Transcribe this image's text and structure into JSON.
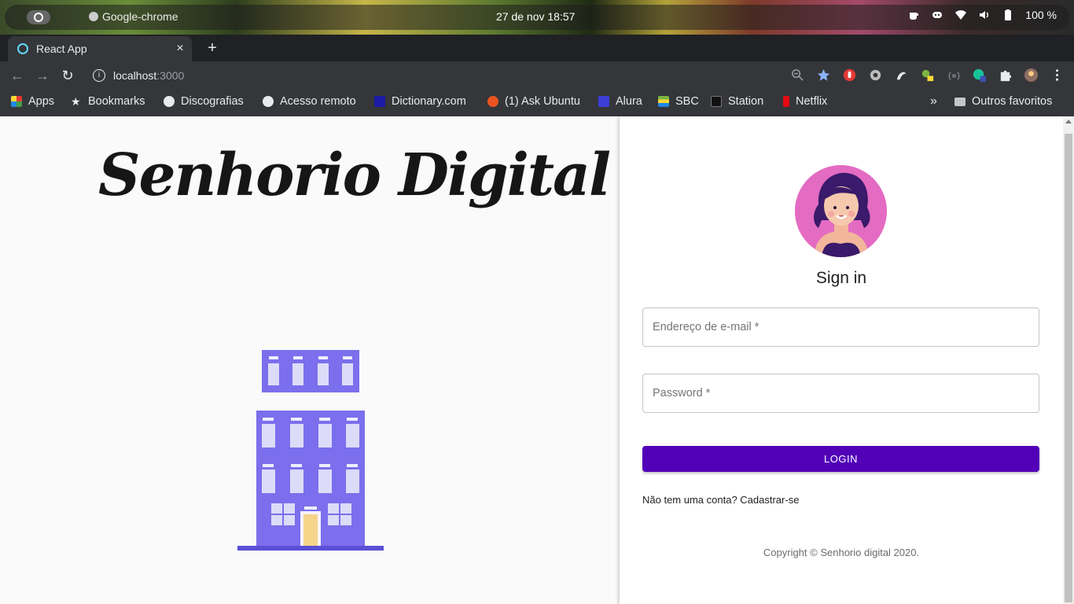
{
  "system_bar": {
    "app_name": "Google-chrome",
    "clock": "27 de nov  18:57",
    "battery": "100 %"
  },
  "browser": {
    "tab_title": "React App",
    "tab_close": "×",
    "new_tab": "+",
    "url_host": "localhost",
    "url_port": ":3000",
    "nav": {
      "back": "←",
      "forward": "→",
      "reload": "↻"
    },
    "bookmarks": [
      {
        "label": "Apps",
        "icon": "apps-grid-icon",
        "color": "#e53935"
      },
      {
        "label": "Bookmarks",
        "icon": "star-icon",
        "color": "#e8eaed"
      },
      {
        "label": "Discografias",
        "icon": "globe-icon",
        "color": "#e8eaed"
      },
      {
        "label": "Acesso remoto",
        "icon": "globe-icon",
        "color": "#e8eaed"
      },
      {
        "label": "Dictionary.com",
        "icon": "dictionary-icon",
        "color": "#1a1aa6"
      },
      {
        "label": "(1) Ask Ubuntu",
        "icon": "ask-ubuntu-icon",
        "color": "#e95420"
      },
      {
        "label": "Alura",
        "icon": "alura-icon",
        "color": "#3c3cd6"
      },
      {
        "label": "SBC",
        "icon": "sbc-icon",
        "color": "#7cb342"
      },
      {
        "label": "Station",
        "icon": "station-icon",
        "color": "#111111"
      },
      {
        "label": "Netflix",
        "icon": "netflix-icon",
        "color": "#e50914"
      }
    ],
    "bookmarks_more": "»",
    "other_bookmarks": "Outros favoritos"
  },
  "page": {
    "brand_title": "Senhorio Digital",
    "signin_title": "Sign in",
    "email_placeholder": "Endereço de e-mail *",
    "password_placeholder": "Password *",
    "login_label": "LOGIN",
    "signup_text": "Não tem uma conta? Cadastrar-se",
    "copyright": "Copyright © Senhorio digital 2020."
  },
  "colors": {
    "accent": "#5200b8",
    "building": "#7b6fed",
    "avatar_bg": "#e46bc2"
  }
}
